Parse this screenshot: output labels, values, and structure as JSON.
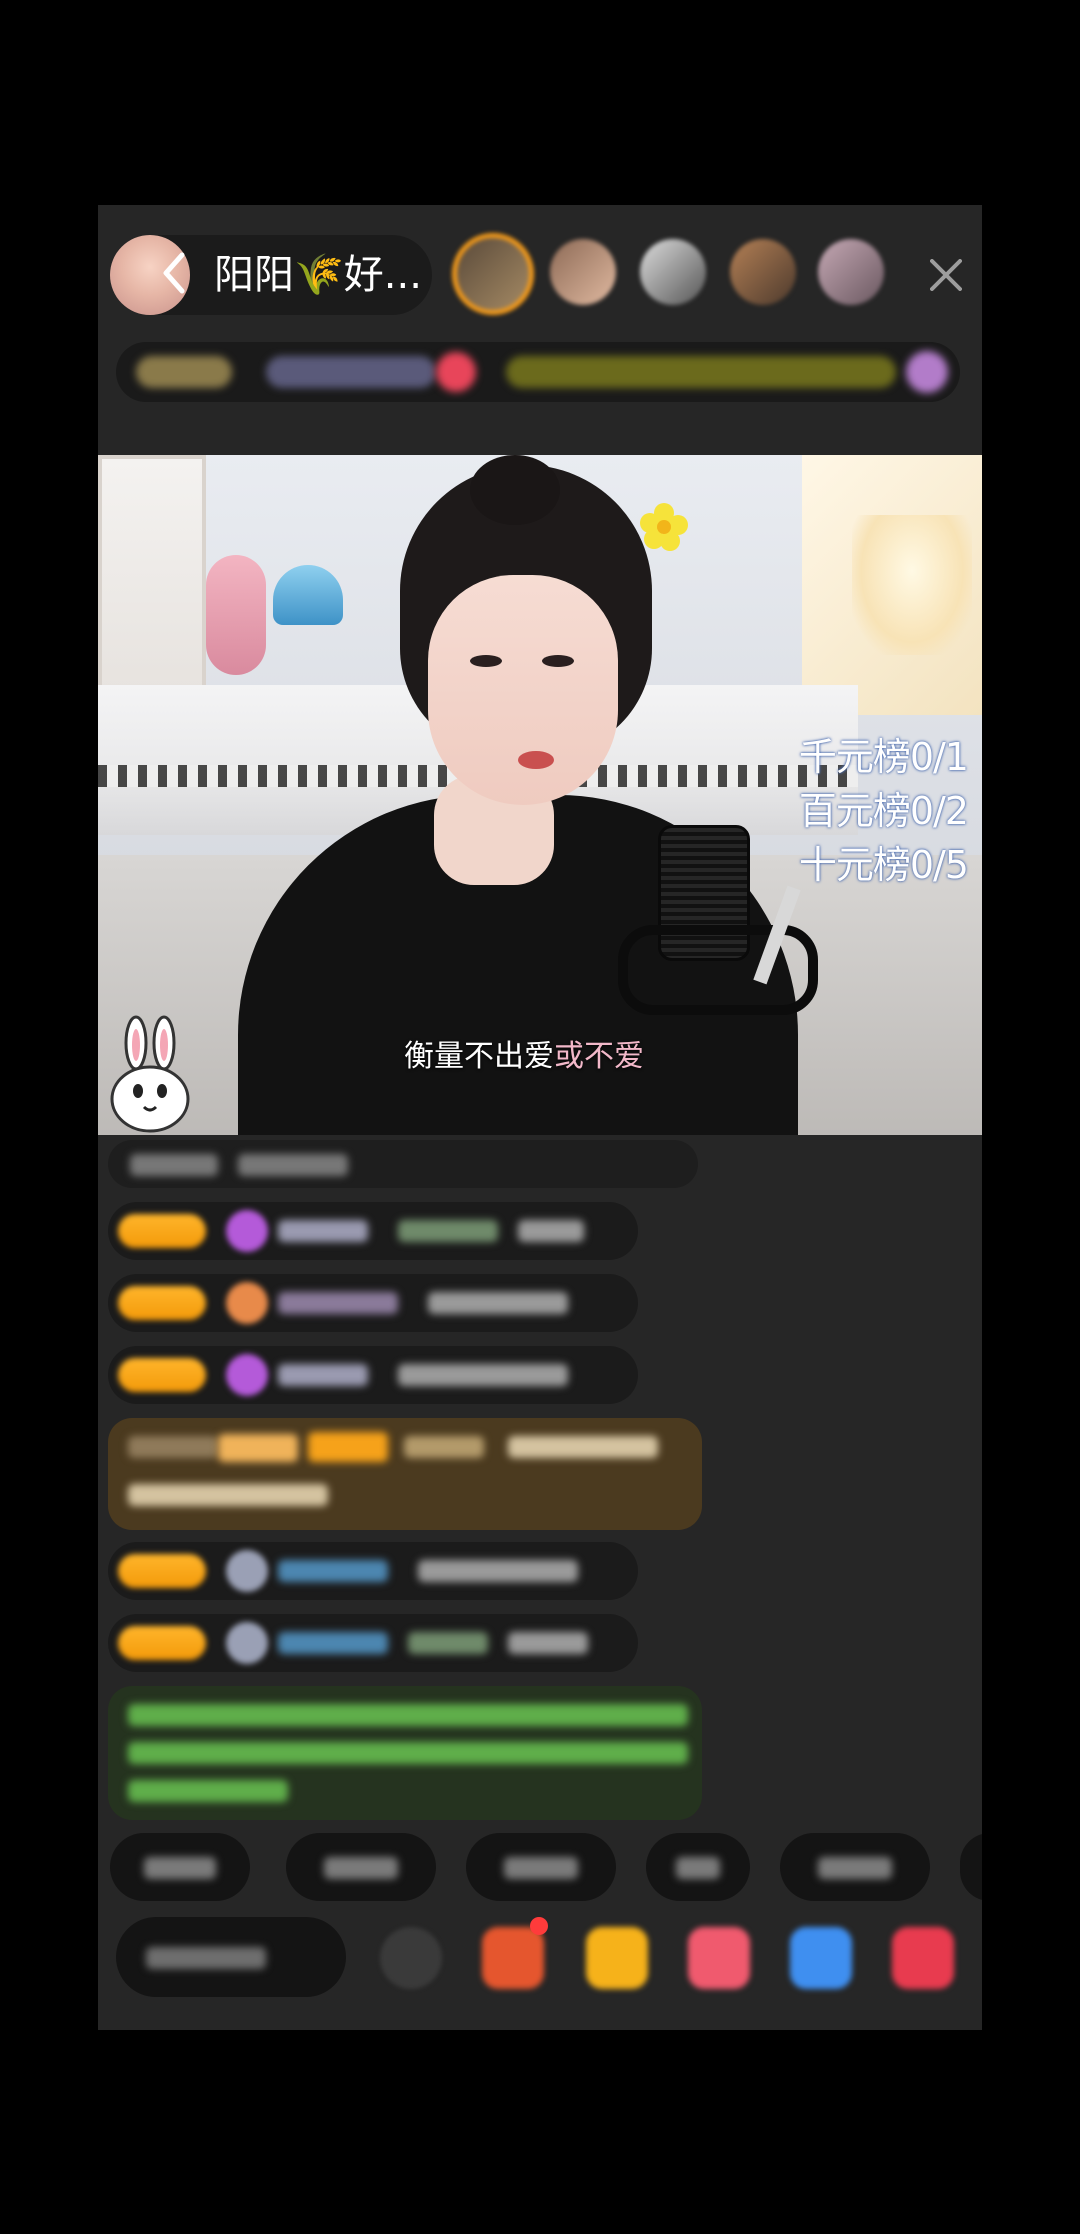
{
  "header": {
    "host_name": "阳阳🌾好...",
    "close_label": "×"
  },
  "video": {
    "rank_lines": [
      "千元榜0/1",
      "百元榜0/2",
      "十元榜0/5"
    ],
    "lyric_main": "衡量不出爱",
    "lyric_accent": "或不爱"
  },
  "colors": {
    "screen_bg": "#262626",
    "badge": "#f7a51a",
    "highlight_msg": "#5a4522",
    "green_msg": "#2b3a25"
  }
}
